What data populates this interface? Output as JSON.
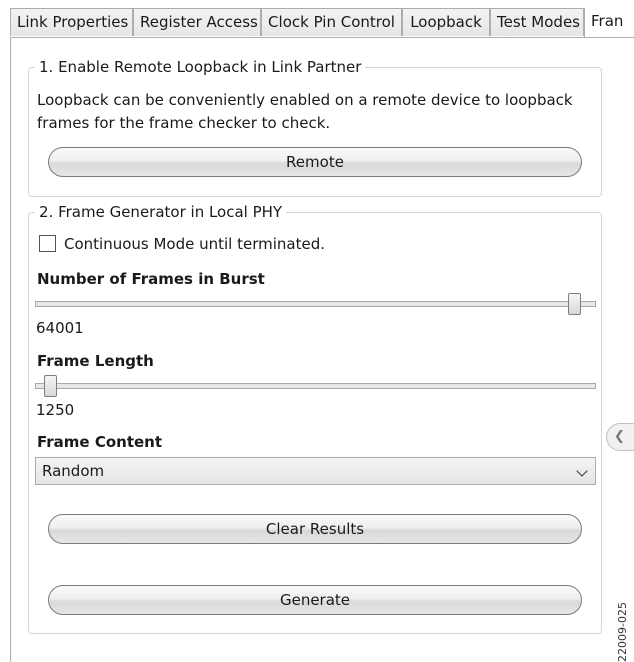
{
  "tabs": [
    {
      "label": "Link Properties"
    },
    {
      "label": "Register Access"
    },
    {
      "label": "Clock Pin Control"
    },
    {
      "label": "Loopback"
    },
    {
      "label": "Test Modes"
    },
    {
      "label": "Fran"
    }
  ],
  "remote_group": {
    "title": "1. Enable Remote Loopback in Link Partner",
    "description": "Loopback can be conveniently enabled on a remote device to loopback frames for the frame checker to check.",
    "remote_button": "Remote"
  },
  "generator_group": {
    "title": "2. Frame Generator in Local PHY",
    "continuous_mode": {
      "label": "Continuous Mode until terminated.",
      "checked": false
    },
    "frames_in_burst": {
      "label": "Number of Frames in Burst",
      "value": "64001"
    },
    "frame_length": {
      "label": "Frame Length",
      "value": "1250"
    },
    "frame_content": {
      "label": "Frame Content",
      "selected": "Random"
    },
    "clear_results_button": "Clear Results",
    "generate_button": "Generate"
  },
  "side_handle_icon": "chevron-left-icon",
  "figure_id": "22009-025"
}
